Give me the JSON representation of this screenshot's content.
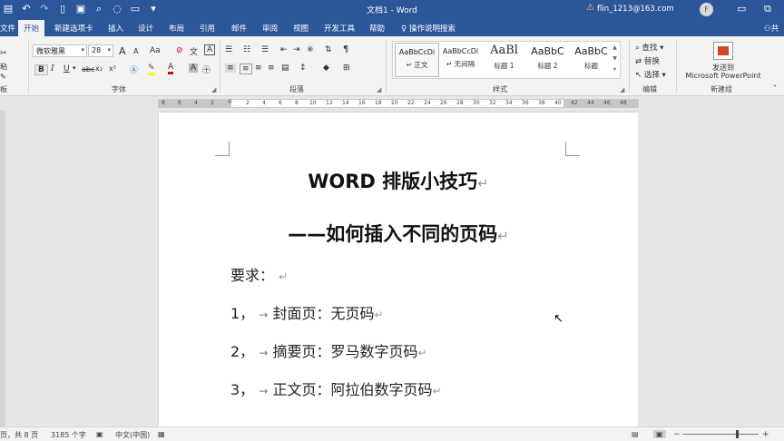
{
  "app": {
    "doc_title": "文档1 - Word",
    "account_email": "flin_1213@163.com",
    "avatar_initial": "F"
  },
  "icons": {
    "qat": [
      "word-icon",
      "undo-icon",
      "redo-icon",
      "new-doc-icon",
      "save-icon",
      "print-preview-icon",
      "quick-print-icon",
      "open-icon",
      "customize-qat-icon"
    ],
    "window": [
      "restore-icon",
      "warning-icon"
    ]
  },
  "tabs": [
    {
      "label": "文件"
    },
    {
      "label": "开始",
      "active": true
    },
    {
      "label": "新建选项卡"
    },
    {
      "label": "插入"
    },
    {
      "label": "设计"
    },
    {
      "label": "布局"
    },
    {
      "label": "引用"
    },
    {
      "label": "邮件"
    },
    {
      "label": "审阅"
    },
    {
      "label": "视图"
    },
    {
      "label": "开发工具"
    },
    {
      "label": "帮助"
    }
  ],
  "tell_me": "操作说明搜索",
  "share_label": "共",
  "ribbon": {
    "clipboard_partial": [
      "粘",
      "贴",
      "板"
    ],
    "font": {
      "name": "微软雅黑",
      "size": "28",
      "group_label": "字体",
      "grow": "A",
      "shrink": "A",
      "case": "Aa",
      "bold": "B",
      "italic": "I",
      "underline": "U",
      "strike": "abc",
      "subscript": "x₂",
      "superscript": "x²",
      "font_color": "A",
      "char_border": "A",
      "phonetic": "文",
      "highlight_glyph": "✎"
    },
    "paragraph": {
      "group_label": "段落"
    },
    "styles": {
      "group_label": "样式",
      "items": [
        {
          "sample": "AaBbCcDi",
          "name": "↵ 正文"
        },
        {
          "sample": "AaBbCcDi",
          "name": "↵ 无间隔"
        },
        {
          "sample": "AaBl",
          "name": "标题 1"
        },
        {
          "sample": "AaBbC",
          "name": "标题 2"
        },
        {
          "sample": "AaBbC",
          "name": "标题"
        }
      ]
    },
    "editing": {
      "group_label": "编辑",
      "find": "查找",
      "replace": "替换",
      "select": "选择"
    },
    "newgroup": {
      "group_label": "新建组",
      "send_to": "发送到",
      "ppt": "Microsoft PowerPoint"
    }
  },
  "ruler": {
    "numbers": [
      "8",
      "6",
      "4",
      "2",
      "2",
      "4",
      "6",
      "8",
      "10",
      "12",
      "14",
      "16",
      "18",
      "20",
      "22",
      "24",
      "26",
      "28",
      "30",
      "32",
      "34",
      "36",
      "38",
      "40",
      "42",
      "44",
      "46",
      "48"
    ]
  },
  "document": {
    "title": "WORD 排版小技巧",
    "subtitle": "——如何插入不同的页码",
    "req": "要求：",
    "items": [
      {
        "num": "1，",
        "text": "封面页：无页码"
      },
      {
        "num": "2，",
        "text": "摘要页：罗马数字页码"
      },
      {
        "num": "3，",
        "text": "正文页：阿拉伯数字页码"
      }
    ],
    "para_mark": "↵",
    "tab_mark": "→"
  },
  "status": {
    "page": "页，共 8 页",
    "words": "3185 个字",
    "lang": "中文(中国)"
  }
}
